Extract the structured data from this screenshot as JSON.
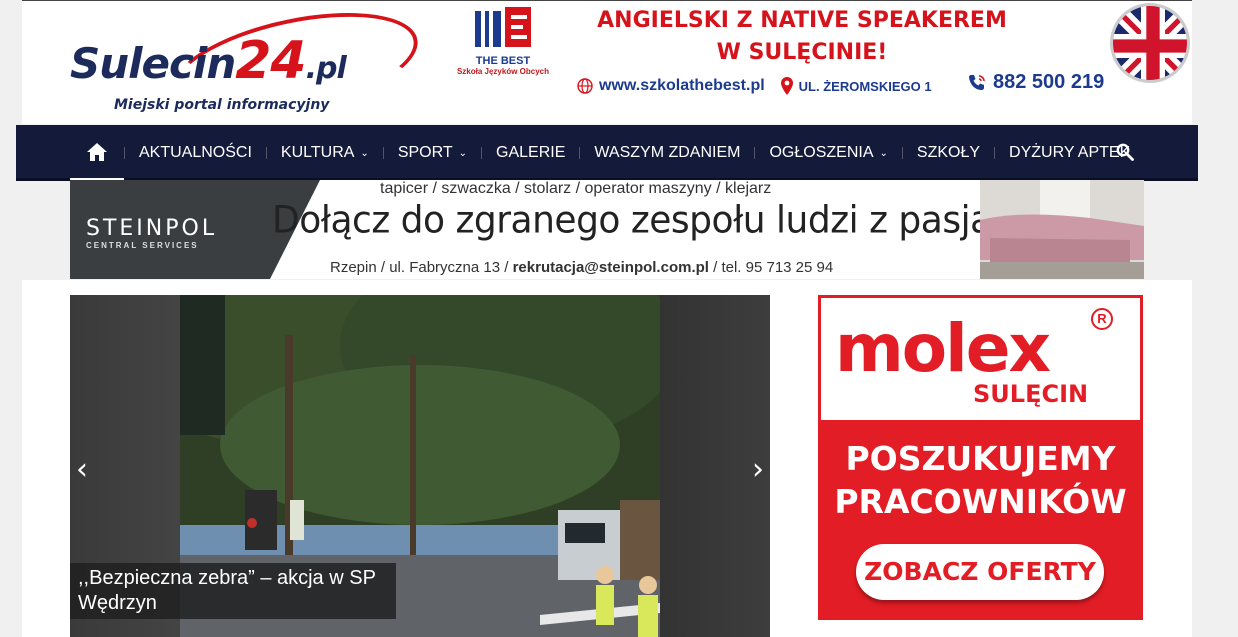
{
  "logo": {
    "name": "Sulecin",
    "number": "24",
    "tld": ".pl",
    "tagline": "Miejski portal informacyjny"
  },
  "ad_thebest": {
    "brand": "THE BEST",
    "brand_sub": "Szkoła Języków Obcych",
    "headline_line1": "ANGIELSKI Z NATIVE SPEAKEREM",
    "headline_line2": "W SULĘCINIE!",
    "website": "www.szkolathebest.pl",
    "address": "UL. ŻEROMSKIEGO 1",
    "phone": "882 500 219"
  },
  "nav": {
    "items": [
      {
        "label": "AKTUALNOŚCI",
        "dropdown": false
      },
      {
        "label": "KULTURA",
        "dropdown": true
      },
      {
        "label": "SPORT",
        "dropdown": true
      },
      {
        "label": "GALERIE",
        "dropdown": false
      },
      {
        "label": "WASZYM ZDANIEM",
        "dropdown": false
      },
      {
        "label": "OGŁOSZENIA",
        "dropdown": true
      },
      {
        "label": "SZKOŁY",
        "dropdown": false
      },
      {
        "label": "DYŻURY APTEK",
        "dropdown": false
      }
    ]
  },
  "ad_steinpol": {
    "brand": "STEINPOL",
    "brand_sub": "CENTRAL SERVICES",
    "jobs": "tapicer  /  szwaczka  /  stolarz  /  operator maszyny  /  klejarz",
    "headline": "Dołącz do zgranego zespołu ludzi z pasją...",
    "address_prefix": "Rzepin / ul. Fabryczna 13 / ",
    "email": "rekrutacja@steinpol.com.pl",
    "address_suffix": " /  tel. 95 713 25 94"
  },
  "slider": {
    "caption": ",,Bezpieczna zebra” – akcja w SP Wędrzyn",
    "prev": "‹",
    "next": "›"
  },
  "ad_molex": {
    "brand": "molex",
    "reg": "R",
    "city": "SULĘCIN",
    "headline_line1": "POSZUKUJEMY",
    "headline_line2": "PRACOWNIKÓW",
    "button": "ZOBACZ OFERTY"
  },
  "colors": {
    "nav_bg": "#141a3a",
    "brand_red": "#d6121a",
    "brand_navy": "#1c2b5b",
    "molex_red": "#e31d25"
  }
}
